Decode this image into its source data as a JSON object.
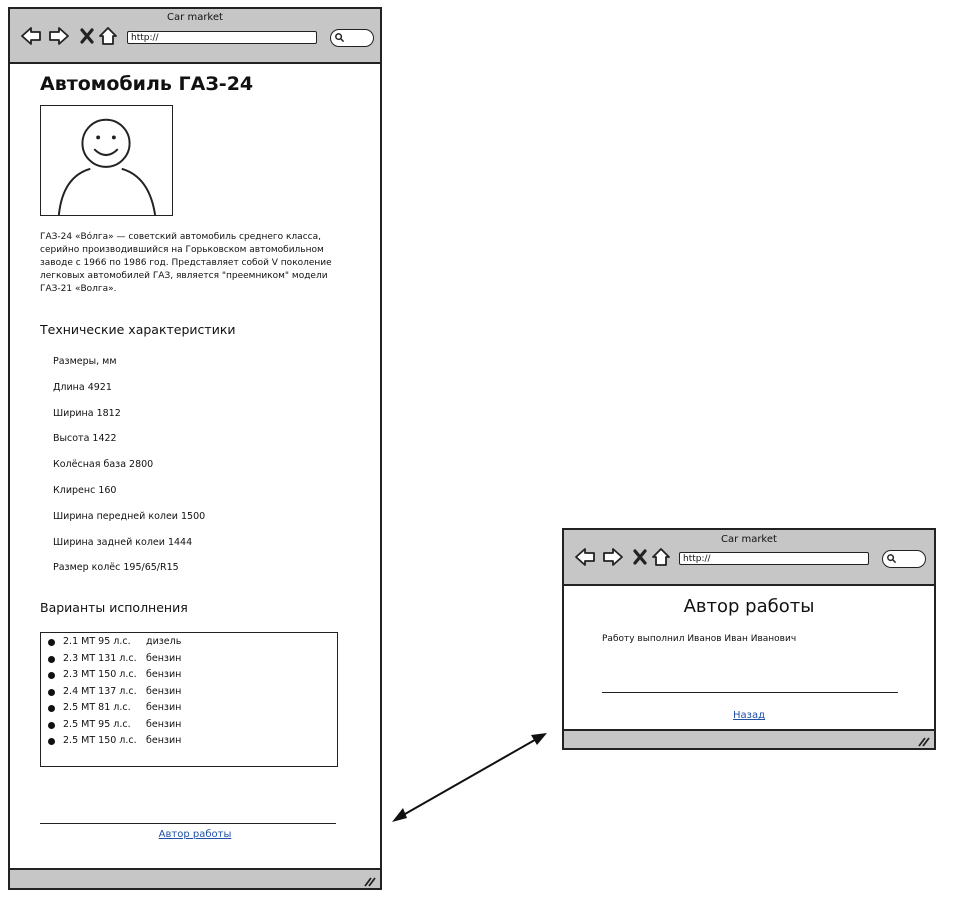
{
  "main_window": {
    "title": "Car market",
    "url": "http://",
    "heading": "Автомобиль ГАЗ-24",
    "description": "ГАЗ-24 «Вóлга» — советский автомобиль среднего класса, серийно производившийся на Горьковском автомобильном заводе с 1966 по 1986 год. Представляет собой V поколение легковых автомобилей ГАЗ, является \"преемником\" модели ГАЗ-21 «Волга».",
    "specs_heading": "Технические характеристики",
    "specs": [
      "Размеры, мм",
      "Длина  4921",
      "Ширина 1812",
      "Высота 1422",
      "Колёсная база 2800",
      "Клиренс 160",
      "Ширина передней колеи 1500",
      "Ширина задней колеи 1444",
      "Размер колёс 195/65/R15"
    ],
    "variants_heading": "Варианты исполнения",
    "variants": [
      {
        "spec": "2.1 МТ   95 л.с.",
        "fuel": "дизель"
      },
      {
        "spec": "2.3 МТ   131 л.с.",
        "fuel": "бензин"
      },
      {
        "spec": "2.3 МТ   150 л.с.",
        "fuel": "бензин"
      },
      {
        "spec": "2.4 МТ   137 л.с.",
        "fuel": "бензин"
      },
      {
        "spec": "2.5 МТ   81 л.с.",
        "fuel": "бензин"
      },
      {
        "spec": "2.5 МТ   95 л.с.",
        "fuel": "бензин"
      },
      {
        "spec": "2.5 МТ   150 л.с.",
        "fuel": "бензин"
      }
    ],
    "footer_link": "Автор работы"
  },
  "author_window": {
    "title": "Car market",
    "url": "http://",
    "heading": "Автор работы",
    "text": "Работу выполнил Иванов Иван Иванович",
    "back_link": "Назад"
  },
  "icons": [
    "back-arrow-icon",
    "forward-arrow-icon",
    "stop-icon",
    "home-icon",
    "search-icon",
    "resize-grip-icon",
    "user-placeholder-icon"
  ],
  "colors": {
    "chrome": "#c6c6c6",
    "link": "#1f4fa6",
    "stroke": "#222222"
  }
}
